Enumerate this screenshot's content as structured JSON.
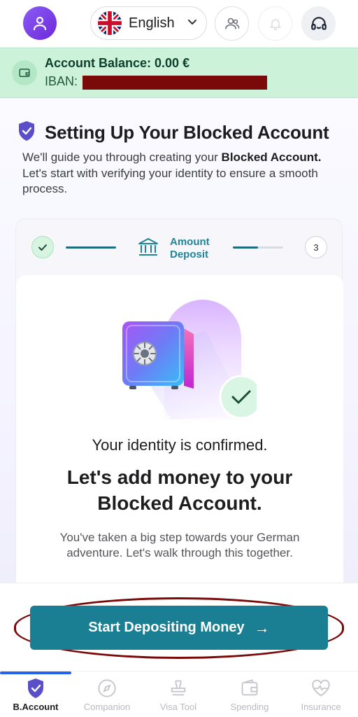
{
  "header": {
    "avatar_icon": "user-icon",
    "language": {
      "label": "English",
      "flag_icon": "uk-flag-icon",
      "chevron_icon": "chevron-down-icon"
    },
    "buttons": [
      {
        "icon": "users-icon"
      },
      {
        "icon": "bell-icon"
      },
      {
        "icon": "headset-icon"
      }
    ]
  },
  "balance": {
    "title": "Account Balance: 0.00 €",
    "iban_label": "IBAN:",
    "icon": "wallet-icon"
  },
  "intro": {
    "title": "Setting Up Your Blocked Account",
    "text_before": "We'll guide you through creating your ",
    "text_bold": "Blocked Account.",
    "text_after": " Let's start with verifying your identity to ensure a smooth process."
  },
  "stepper": {
    "step1_status": "complete",
    "current_step_line1": "Amount",
    "current_step_line2": "Deposit",
    "step3_number": "3",
    "current_progress": 0.5
  },
  "card": {
    "confirmed_text": "Your identity is confirmed.",
    "headline": "Let's add money to your Blocked Account.",
    "subtext": "You've taken a big step towards your German adventure. Let's walk through this together."
  },
  "cta": {
    "label": "Start Depositing Money",
    "arrow": "→"
  },
  "nav": {
    "items": [
      {
        "label": "B.Account",
        "icon": "shield-icon",
        "active": true
      },
      {
        "label": "Companion",
        "icon": "compass-icon",
        "active": false
      },
      {
        "label": "Visa Tool",
        "icon": "stamp-icon",
        "active": false
      },
      {
        "label": "Spending",
        "icon": "wallet-icon",
        "active": false
      },
      {
        "label": "Insurance",
        "icon": "heart-pulse-icon",
        "active": false
      }
    ]
  },
  "colors": {
    "primary": "#1a7f92",
    "balance_bg": "#cdf2da",
    "avatar": "#7c3aed",
    "annotation": "#7a0a0a",
    "nav_indicator": "#2563eb"
  }
}
